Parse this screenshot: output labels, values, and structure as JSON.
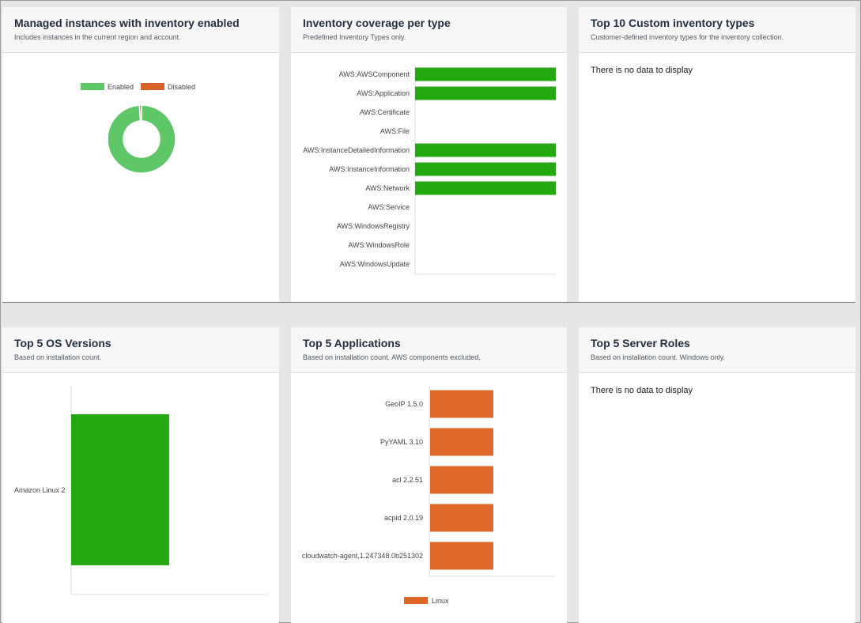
{
  "colors": {
    "enabled": "#5fc767",
    "disabled": "#d86128",
    "bar_green": "#26a812",
    "bar_orange": "#dd6727",
    "axis": "#dcdcdc",
    "label": "#444444"
  },
  "cards": {
    "managed": {
      "title": "Managed instances with inventory enabled",
      "subtitle": "Includes instances in the current region and account."
    },
    "coverage": {
      "title": "Inventory coverage per type",
      "subtitle": "Predefined Inventory Types only."
    },
    "custom": {
      "title": "Top 10 Custom inventory types",
      "subtitle": "Customer-defined inventory types for the inventory collection.",
      "empty_text": "There is no data to display"
    },
    "os": {
      "title": "Top 5 OS Versions",
      "subtitle": "Based on installation count."
    },
    "apps": {
      "title": "Top 5 Applications",
      "subtitle": "Based on installation count. AWS components excluded."
    },
    "roles": {
      "title": "Top 5 Server Roles",
      "subtitle": "Based on installation count. Windows only.",
      "empty_text": "There is no data to display"
    }
  },
  "chart_data": [
    {
      "id": "managed",
      "type": "pie",
      "donut": true,
      "legend": [
        "Enabled",
        "Disabled"
      ],
      "legend_placement": "top",
      "slices": [
        {
          "label": "Enabled",
          "value": 99
        },
        {
          "label": "Disabled",
          "value": 1
        }
      ]
    },
    {
      "id": "coverage",
      "type": "bar",
      "orientation": "horizontal",
      "categories": [
        "AWS:AWSComponent",
        "AWS:Application",
        "AWS:Certificate",
        "AWS:File",
        "AWS:InstanceDetailedInformation",
        "AWS:InstanceInformation",
        "AWS:Network",
        "AWS:Service",
        "AWS:WindowsRegistry",
        "AWS:WindowsRole",
        "AWS:WindowsUpdate"
      ],
      "values": [
        1,
        1,
        0,
        0,
        1,
        1,
        1,
        0,
        0,
        0,
        0
      ],
      "xlim": [
        0,
        1
      ]
    },
    {
      "id": "os",
      "type": "bar",
      "orientation": "horizontal",
      "categories": [
        "Amazon Linux 2"
      ],
      "values": [
        1
      ],
      "xlim": [
        0,
        2
      ]
    },
    {
      "id": "apps",
      "type": "bar",
      "orientation": "horizontal",
      "categories": [
        "GeoIP 1.5.0",
        "PyYAML 3.10",
        "acl 2.2.51",
        "acpid 2.0.19",
        "cloudwatch-agent,1.247348.0b251302"
      ],
      "series": [
        {
          "name": "Linux",
          "values": [
            1,
            1,
            1,
            1,
            1
          ]
        }
      ],
      "xlim": [
        0,
        2.5
      ],
      "legend_placement": "bottom"
    }
  ]
}
